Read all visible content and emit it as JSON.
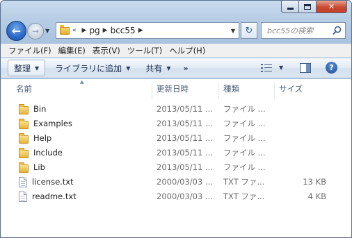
{
  "window": {
    "caption_buttons": [
      "minimize",
      "maximize",
      "close"
    ],
    "accent_color": "#2a68c6",
    "close_color": "#c9492f"
  },
  "nav": {
    "overflow_marker": "«",
    "breadcrumbs": [
      "pg",
      "bcc55"
    ],
    "search_placeholder": "bcc55の検索"
  },
  "menubar": {
    "items": [
      "ファイル(F)",
      "編集(E)",
      "表示(V)",
      "ツール(T)",
      "ヘルプ(H)"
    ]
  },
  "commandbar": {
    "organize": "整理",
    "add_to_library": "ライブラリに追加",
    "share": "共有",
    "more": "»"
  },
  "filelist": {
    "columns": {
      "name": "名前",
      "date": "更新日時",
      "type": "種類",
      "size": "サイズ"
    },
    "rows": [
      {
        "icon": "folder-icon",
        "name": "Bin",
        "date": "2013/05/11 ...",
        "type": "ファイル ...",
        "size": ""
      },
      {
        "icon": "folder-icon",
        "name": "Examples",
        "date": "2013/05/11 ...",
        "type": "ファイル ...",
        "size": ""
      },
      {
        "icon": "folder-icon",
        "name": "Help",
        "date": "2013/05/11 ...",
        "type": "ファイル ...",
        "size": ""
      },
      {
        "icon": "folder-icon",
        "name": "Include",
        "date": "2013/05/11 ...",
        "type": "ファイル ...",
        "size": ""
      },
      {
        "icon": "folder-icon",
        "name": "Lib",
        "date": "2013/05/11 ...",
        "type": "ファイル ...",
        "size": ""
      },
      {
        "icon": "text-file-icon",
        "name": "license.txt",
        "date": "2000/03/03 ...",
        "type": "TXT ファ...",
        "size": "13 KB"
      },
      {
        "icon": "text-file-icon",
        "name": "readme.txt",
        "date": "2000/03/03 ...",
        "type": "TXT ファ...",
        "size": "4 KB"
      }
    ]
  }
}
